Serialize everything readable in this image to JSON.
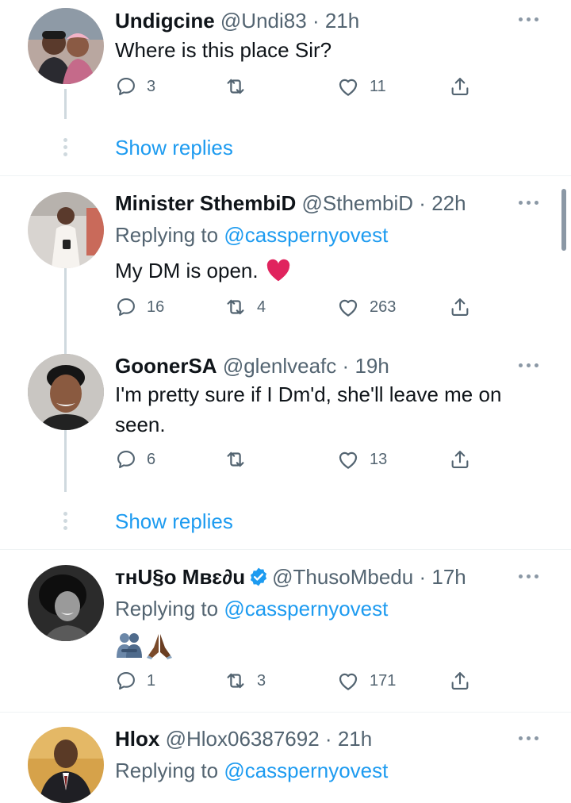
{
  "tweets": [
    {
      "name": "Undigcine",
      "handle": "@Undi83",
      "dot": "·",
      "time": "21h",
      "replying_prefix": "",
      "replying_handle": "",
      "text": "Where is this place Sir?",
      "replies": "3",
      "retweets": "",
      "likes": "11",
      "show_replies": "Show replies"
    },
    {
      "name": "Minister SthembiD",
      "handle": "@SthembiD",
      "dot": "·",
      "time": "22h",
      "replying_prefix": "Replying to ",
      "replying_handle": "@casspernyovest",
      "text": "My DM is open.",
      "replies": "16",
      "retweets": "4",
      "likes": "263"
    },
    {
      "name": "GoonerSA",
      "handle": "@glenlveafc",
      "dot": "·",
      "time": "19h",
      "text_line1": "I'm pretty sure if I Dm'd, she'll leave me on",
      "text_line2": "seen.",
      "replies": "6",
      "retweets": "",
      "likes": "13",
      "show_replies": "Show replies"
    },
    {
      "name": "ᴛʜU§ᴏ Mʙɛ∂u",
      "handle": "@ThusoMbedu",
      "dot": "·",
      "time": "17h",
      "replying_prefix": "Replying to ",
      "replying_handle": "@casspernyovest",
      "replies": "1",
      "retweets": "3",
      "likes": "171"
    },
    {
      "name": "Hlox",
      "handle": "@Hlox06387692",
      "dot": "·",
      "time": "21h",
      "replying_prefix": "Replying to ",
      "replying_handle": "@casspernyovest"
    }
  ],
  "icons": {
    "reply": "reply-icon",
    "retweet": "retweet-icon",
    "like": "heart-icon",
    "share": "share-icon",
    "more": "more-icon",
    "verified": "verified-badge-icon",
    "heart_emoji": "red-heart-emoji",
    "hug_emoji": "hugging-people-emoji",
    "pray_emoji": "folded-hands-emoji"
  },
  "colors": {
    "link": "#1d9bf0",
    "secondary_text": "#536471",
    "heart_emoji": "#e0245e",
    "divider": "#eff3f4"
  }
}
